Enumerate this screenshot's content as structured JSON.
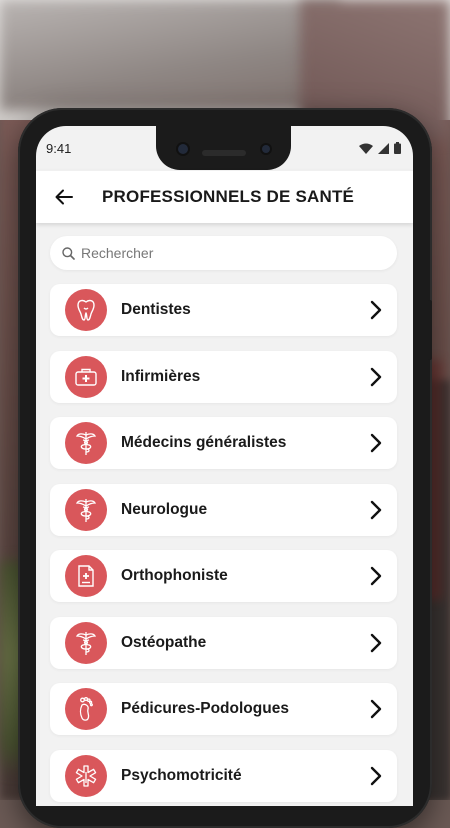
{
  "status": {
    "time": "9:41"
  },
  "header": {
    "title": "PROFESSIONNELS DE SANTÉ"
  },
  "search": {
    "placeholder": "Rechercher"
  },
  "accent_color": "#d9575b",
  "categories": [
    {
      "label": "Dentistes",
      "icon": "tooth-icon"
    },
    {
      "label": "Infirmières",
      "icon": "medical-kit-icon"
    },
    {
      "label": "Médecins généralistes",
      "icon": "caduceus-icon"
    },
    {
      "label": "Neurologue",
      "icon": "caduceus-icon"
    },
    {
      "label": "Orthophoniste",
      "icon": "medical-document-icon"
    },
    {
      "label": "Ostéopathe",
      "icon": "caduceus-icon"
    },
    {
      "label": "Pédicures-Podologues",
      "icon": "foot-icon"
    },
    {
      "label": "Psychomotricité",
      "icon": "star-of-life-icon"
    }
  ]
}
